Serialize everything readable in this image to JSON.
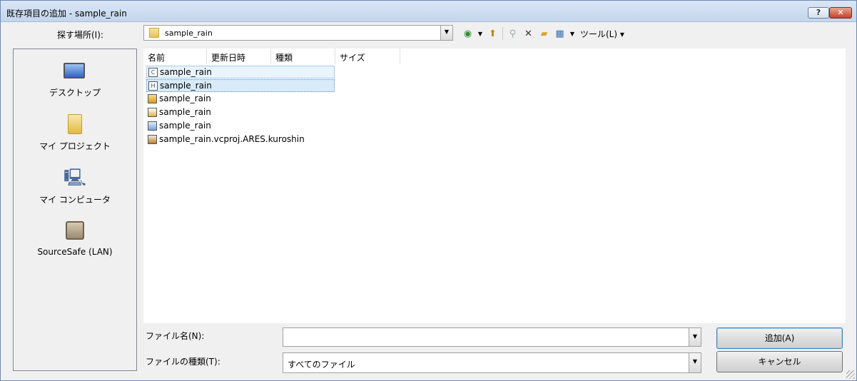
{
  "window": {
    "title": "既存項目の追加 - sample_rain",
    "help_label": "?",
    "close_label": "✕"
  },
  "lookin": {
    "label": "探す場所(I):",
    "value": "sample_rain"
  },
  "toolbar": {
    "tools_label": "ツール(L)"
  },
  "places": [
    {
      "label": "デスクトップ",
      "icon": "desktop-icon"
    },
    {
      "label": "マイ プロジェクト",
      "icon": "project-folder-icon"
    },
    {
      "label": "マイ コンピュータ",
      "icon": "computer-icon"
    },
    {
      "label": "SourceSafe (LAN)",
      "icon": "sourcesafe-icon"
    }
  ],
  "columns": {
    "name": "名前",
    "date": "更新日時",
    "type": "種類",
    "size": "サイズ"
  },
  "files": [
    {
      "name": "sample_rain",
      "icon": "cpp-file-icon",
      "glyph": "C"
    },
    {
      "name": "sample_rain",
      "icon": "header-file-icon",
      "glyph": "H"
    },
    {
      "name": "sample_rain",
      "icon": "icon-file-icon",
      "glyph": ""
    },
    {
      "name": "sample_rain",
      "icon": "resource-file-icon",
      "glyph": ""
    },
    {
      "name": "sample_rain",
      "icon": "project-config-icon",
      "glyph": ""
    },
    {
      "name": "sample_rain.vcproj.ARES.kuroshin",
      "icon": "user-settings-file-icon",
      "glyph": ""
    }
  ],
  "filename": {
    "label": "ファイル名(N):",
    "value": ""
  },
  "filetype": {
    "label": "ファイルの種類(T):",
    "value": "すべてのファイル"
  },
  "buttons": {
    "add": "追加(A)",
    "cancel": "キャンセル"
  }
}
